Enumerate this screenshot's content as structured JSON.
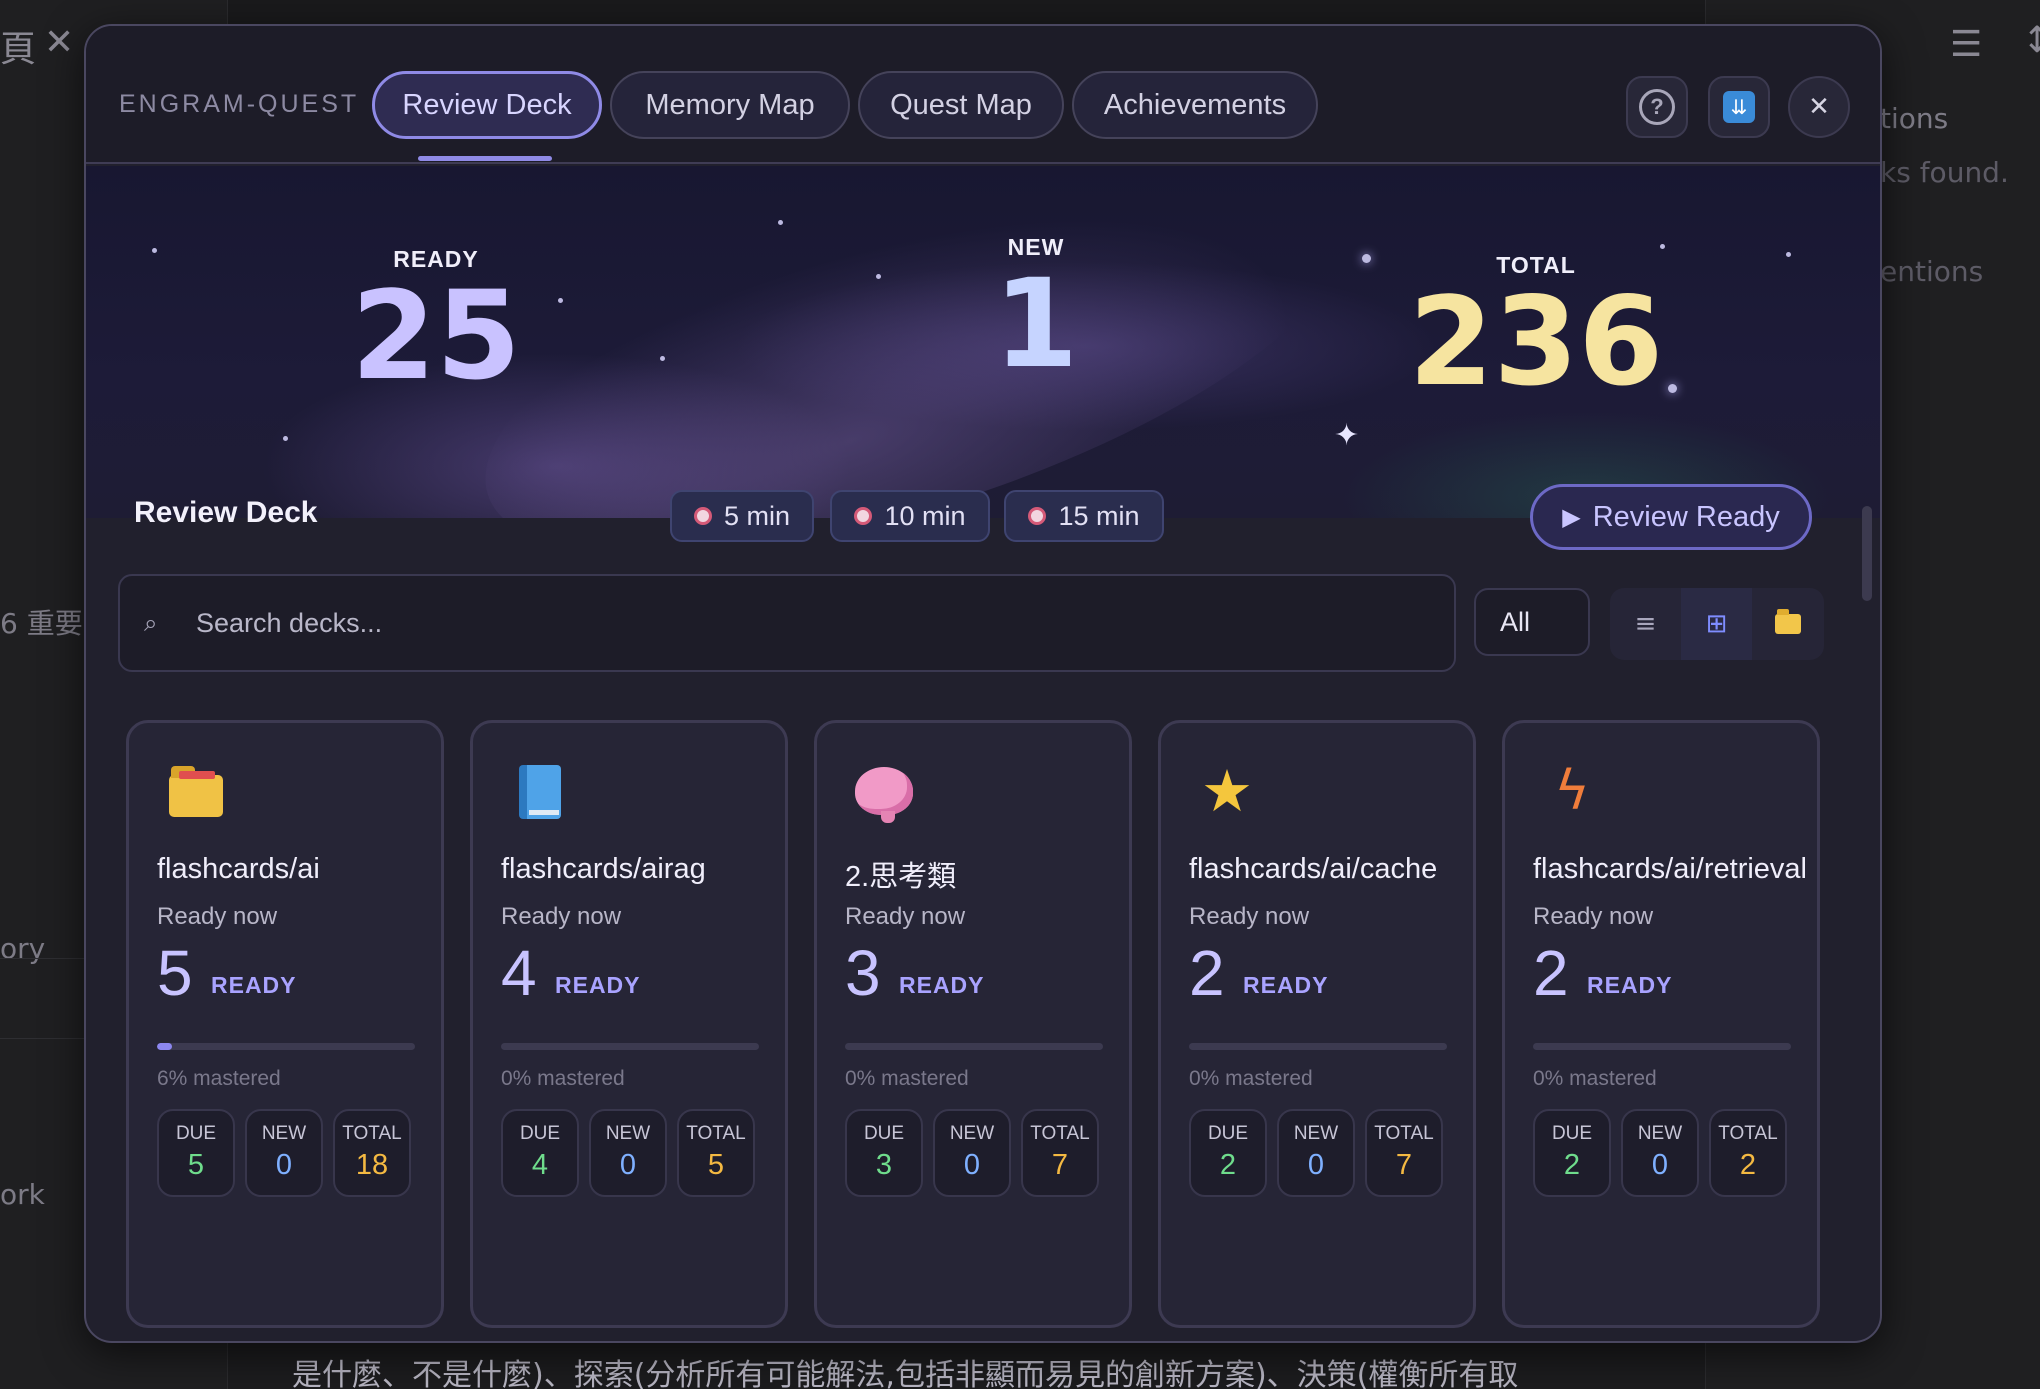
{
  "background": {
    "right_texts": [
      "tions",
      "ks found.",
      "entions"
    ],
    "left_texts": [
      "6 重要",
      "ory",
      "ork",
      "頁"
    ],
    "bottom_text": "是什麼、不是什麼)、探索(分析所有可能解法,包括非顯而易見的創新方案)、決策(權衡所有取"
  },
  "header": {
    "brand": "ENGRAM-QUEST",
    "tabs": [
      {
        "label": "Review Deck",
        "active": true
      },
      {
        "label": "Memory Map",
        "active": false
      },
      {
        "label": "Quest Map",
        "active": false
      },
      {
        "label": "Achievements",
        "active": false
      }
    ],
    "help_icon": "help-circle-icon",
    "download_icon": "download-icon",
    "close_symbol": "✕"
  },
  "hero": {
    "ready": {
      "label": "READY",
      "value": "25",
      "color": "#c9c2ff"
    },
    "new": {
      "label": "NEW",
      "value": "1",
      "color": "#c6d4ff"
    },
    "total": {
      "label": "TOTAL",
      "value": "236",
      "color": "#f6e4a0"
    }
  },
  "toolbar": {
    "title": "Review Deck",
    "time_chips": [
      "5 min",
      "10 min",
      "15 min"
    ],
    "review_button": "Review Ready",
    "search_placeholder": "Search decks...",
    "filter_value": "All",
    "view_modes": [
      "list-icon",
      "grid-icon",
      "folder-icon"
    ],
    "active_view": "grid-icon"
  },
  "stat_colors": {
    "due": "#6fdc8c",
    "new": "#7fb0ff",
    "total": "#f4b942"
  },
  "decks": [
    {
      "icon": "folder",
      "name": "flashcards/ai",
      "status": "Ready now",
      "ready": "5",
      "ready_label": "READY",
      "mastered_fraction": 0.06,
      "mastered_text": "6% mastered",
      "due": "5",
      "new": "0",
      "total": "18"
    },
    {
      "icon": "book",
      "name": "flashcards/airag",
      "status": "Ready now",
      "ready": "4",
      "ready_label": "READY",
      "mastered_fraction": 0.0,
      "mastered_text": "0% mastered",
      "due": "4",
      "new": "0",
      "total": "5"
    },
    {
      "icon": "brain",
      "name": "2.思考類",
      "status": "Ready now",
      "ready": "3",
      "ready_label": "READY",
      "mastered_fraction": 0.0,
      "mastered_text": "0% mastered",
      "due": "3",
      "new": "0",
      "total": "7"
    },
    {
      "icon": "star",
      "name": "flashcards/ai/cache",
      "status": "Ready now",
      "ready": "2",
      "ready_label": "READY",
      "mastered_fraction": 0.0,
      "mastered_text": "0% mastered",
      "due": "2",
      "new": "0",
      "total": "7"
    },
    {
      "icon": "bolt",
      "name": "flashcards/ai/retrieval",
      "status": "Ready now",
      "ready": "2",
      "ready_label": "READY",
      "mastered_fraction": 0.0,
      "mastered_text": "0% mastered",
      "due": "2",
      "new": "0",
      "total": "2"
    }
  ],
  "mini_labels": {
    "due": "DUE",
    "new": "NEW",
    "total": "TOTAL"
  }
}
